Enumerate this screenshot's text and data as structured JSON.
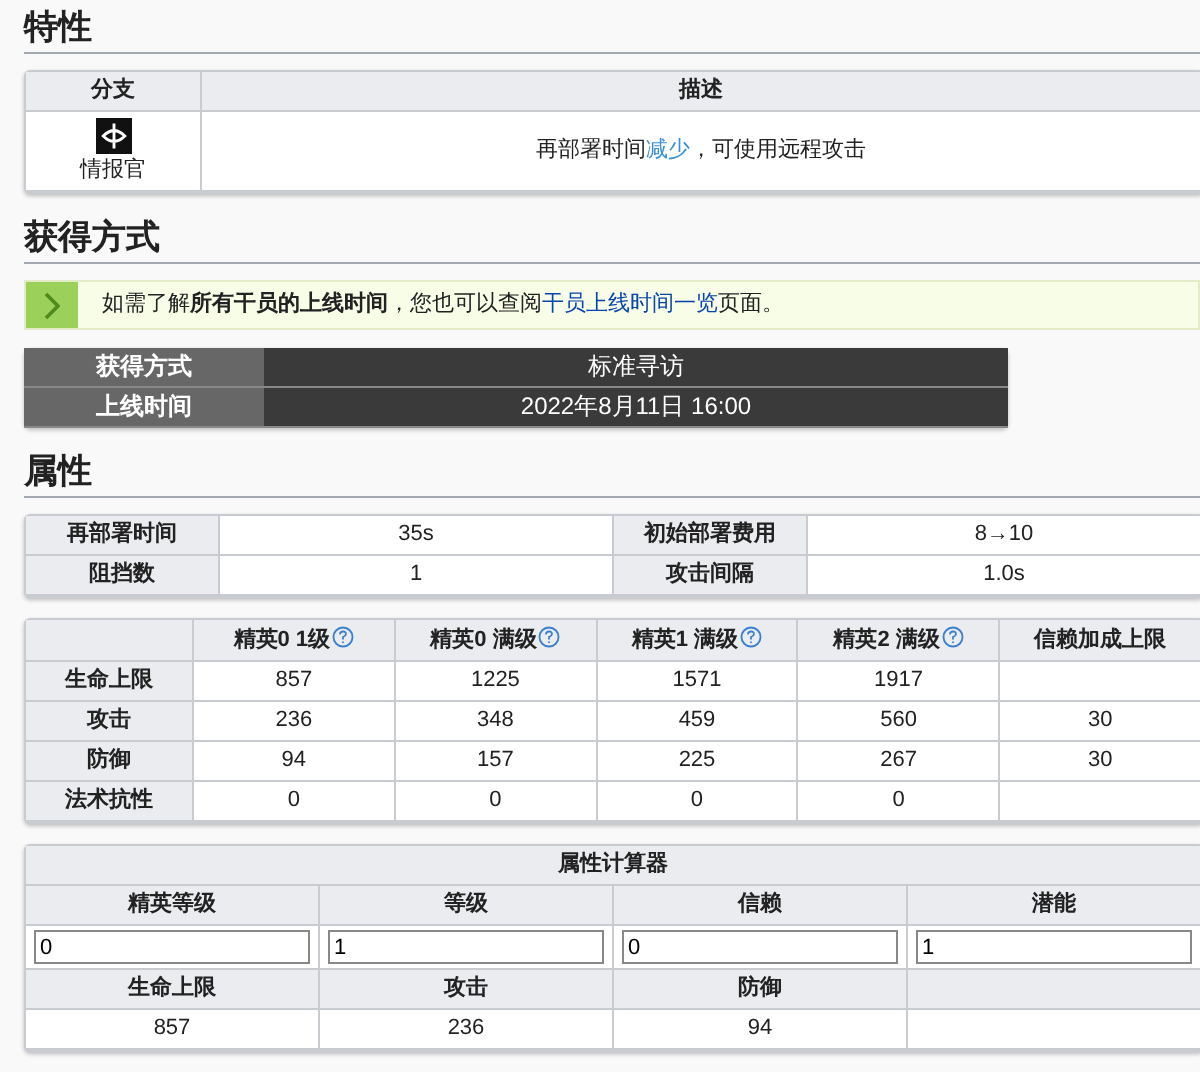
{
  "trait": {
    "heading": "特性",
    "columns": [
      "分支",
      "描述"
    ],
    "branch": "情报官",
    "description": [
      {
        "text": "再部署时间",
        "link": false
      },
      {
        "text": "减少",
        "link": true
      },
      {
        "text": "，可使用远程攻击",
        "link": false
      }
    ]
  },
  "obtain": {
    "heading": "获得方式",
    "notice": [
      {
        "text": "如需了解**所有干员的上线时间**，您也可以查阅",
        "link": false
      },
      {
        "text": "干员上线时间一览",
        "link": true
      },
      {
        "text": "页面。",
        "link": false
      }
    ],
    "rows": [
      {
        "label": "获得方式",
        "value": "标准寻访"
      },
      {
        "label": "上线时间",
        "value": "2022年8月11日 16:00"
      }
    ]
  },
  "attributes": {
    "heading": "属性",
    "basics": [
      [
        "再部署时间",
        "35s",
        "初始部署费用",
        "8→10"
      ],
      [
        "阻挡数",
        "1",
        "攻击间隔",
        "1.0s"
      ]
    ],
    "columns": [
      {
        "label": "精英0 1级",
        "help": true
      },
      {
        "label": "精英0 满级",
        "help": true
      },
      {
        "label": "精英1 满级",
        "help": true
      },
      {
        "label": "精英2 满级",
        "help": true
      },
      {
        "label": "信赖加成上限",
        "help": false
      }
    ],
    "rows": [
      {
        "label": "生命上限",
        "values": [
          "857",
          "1225",
          "1571",
          "1917"
        ]
      },
      {
        "label": "攻击",
        "values": [
          "236",
          "348",
          "459",
          "560"
        ],
        "trust": "30"
      },
      {
        "label": "防御",
        "values": [
          "94",
          "157",
          "225",
          "267"
        ],
        "trust": "30"
      },
      {
        "label": "法术抗性",
        "values": [
          "0",
          "0",
          "0",
          "0"
        ]
      }
    ]
  },
  "calculator": {
    "title": "属性计算器",
    "inputs": [
      {
        "label": "精英等级",
        "value": "0"
      },
      {
        "label": "等级",
        "value": "1"
      },
      {
        "label": "信赖",
        "value": "0"
      },
      {
        "label": "潜能",
        "value": "1"
      }
    ],
    "outputs": [
      {
        "label": "生命上限",
        "value": "857"
      },
      {
        "label": "攻击",
        "value": "236"
      },
      {
        "label": "防御",
        "value": "94"
      }
    ]
  }
}
